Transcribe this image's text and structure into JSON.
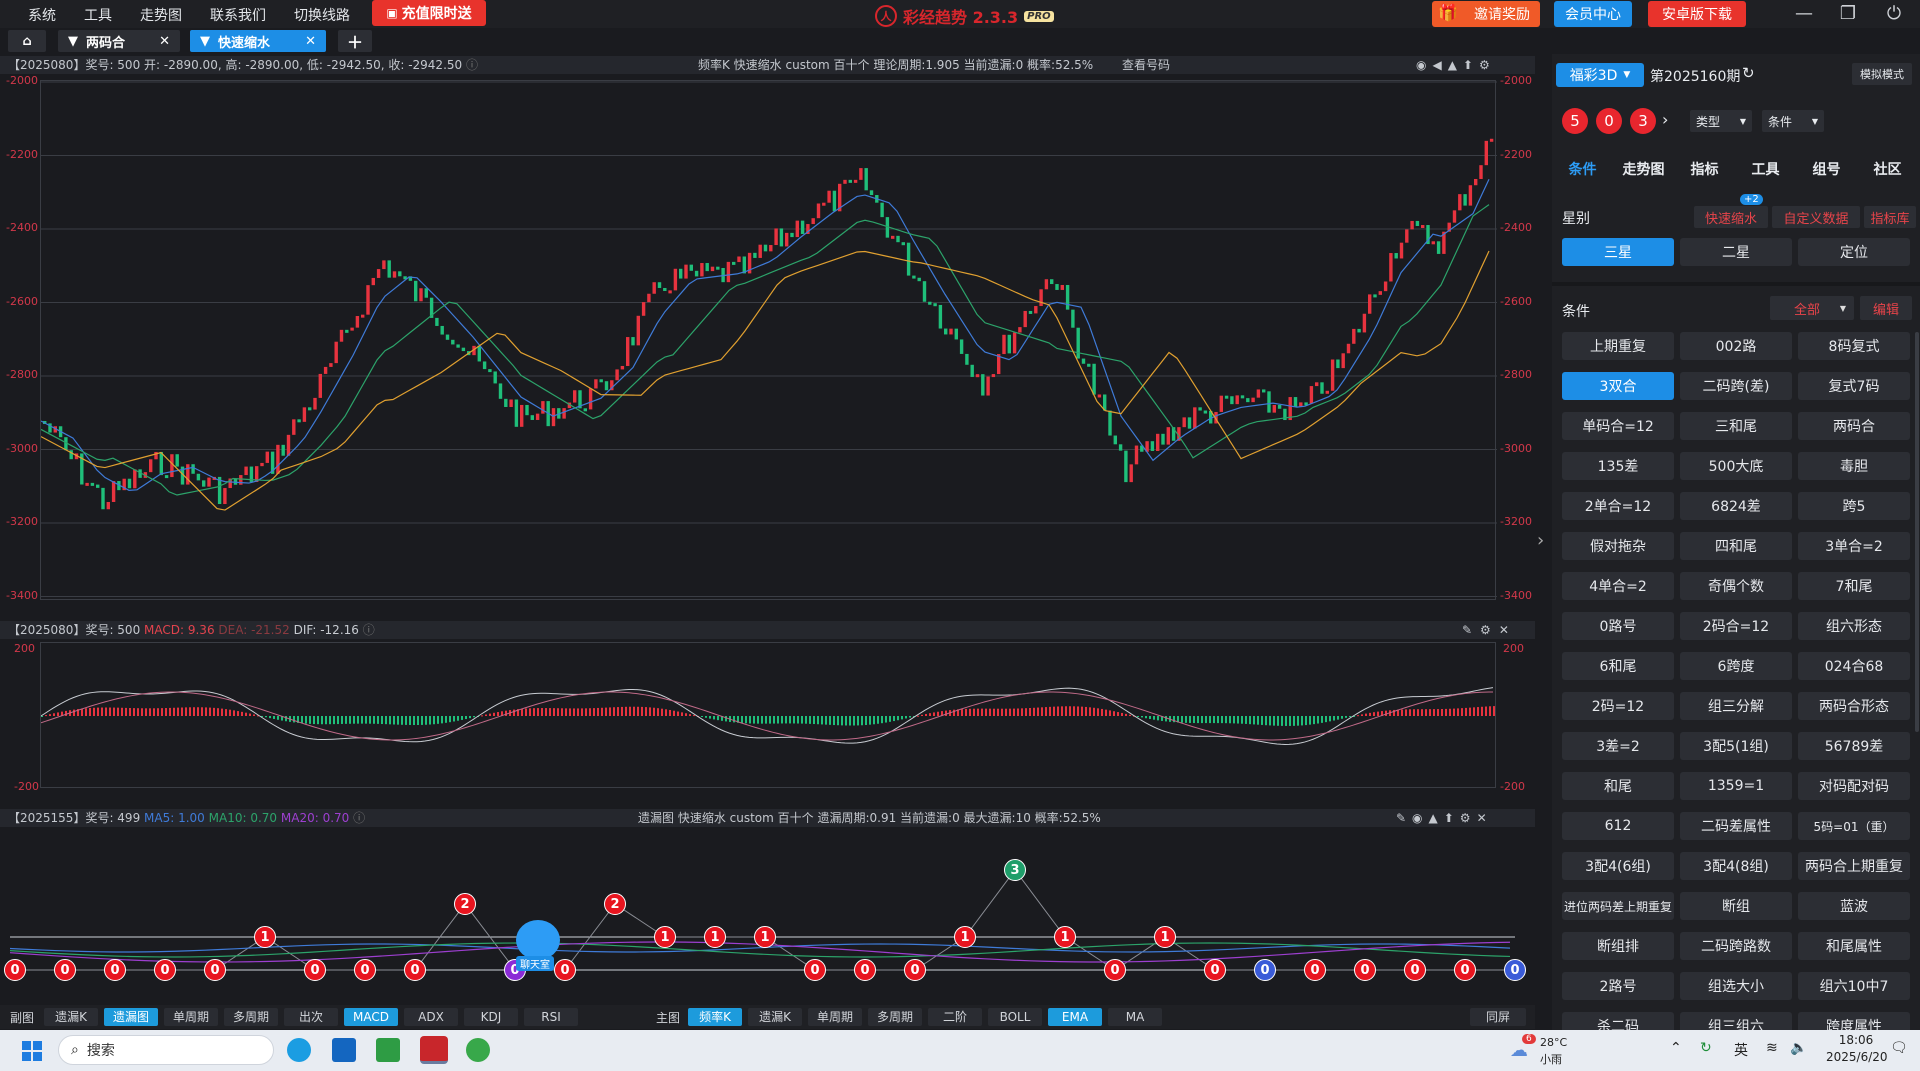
{
  "menu": [
    "系统",
    "工具",
    "走势图",
    "联系我们",
    "切换线路"
  ],
  "promo": "充值限时送",
  "app_title": "彩经趋势 2.3.3",
  "app_badge": "PRO",
  "invite": "邀请奖励",
  "member_center": "会员中心",
  "android_download": "安卓版下载",
  "tabs": [
    {
      "label": "两码合"
    },
    {
      "label": "快速缩水"
    }
  ],
  "chart1": {
    "header_left": "【2025080】奖号: 500  开: -2890.00, 高: -2890.00, 低: -2942.50, 收: -2942.50",
    "header_mid": "频率K  快速缩水  custom  百十个  理论周期:1.905  当前遗漏:0  概率:52.5%",
    "view_number": "查看号码",
    "y_ticks": [
      "-2000",
      "-2200",
      "-2400",
      "-2600",
      "-2800",
      "-3000",
      "-3200",
      "-3400"
    ]
  },
  "chart2": {
    "header_prefix": "【2025080】奖号: 500 ",
    "macd": "MACD: 9.36",
    "dea": "DEA: -21.52",
    "dif": "DIF: -12.16",
    "y_ticks": [
      "200",
      "-200"
    ]
  },
  "chart3": {
    "header_prefix": "【2025155】奖号: 499 ",
    "ma5": "MA5: 1.00",
    "ma10": "MA10: 0.70",
    "ma20": "MA20: 0.70",
    "header_mid": "遗漏图  快速缩水  custom  百十个  遗漏周期:0.91  当前遗漏:0  最大遗漏:10  概率:52.5%",
    "chat_label": "聊天室",
    "balls": [
      {
        "v": "0",
        "c": "#e8151f"
      },
      {
        "v": "0",
        "c": "#e8151f"
      },
      {
        "v": "0",
        "c": "#e8151f"
      },
      {
        "v": "0",
        "c": "#e8151f"
      },
      {
        "v": "0",
        "c": "#e8151f"
      },
      {
        "v": "1",
        "c": "#e8151f"
      },
      {
        "v": "0",
        "c": "#e8151f"
      },
      {
        "v": "0",
        "c": "#e8151f"
      },
      {
        "v": "0",
        "c": "#e8151f"
      },
      {
        "v": "2",
        "c": "#e8151f"
      },
      {
        "v": "0",
        "c": "#8b2bd6"
      },
      {
        "v": "0",
        "c": "#e8151f"
      },
      {
        "v": "2",
        "c": "#e8151f"
      },
      {
        "v": "1",
        "c": "#e8151f"
      },
      {
        "v": "1",
        "c": "#e8151f"
      },
      {
        "v": "1",
        "c": "#e8151f"
      },
      {
        "v": "0",
        "c": "#e8151f"
      },
      {
        "v": "0",
        "c": "#e8151f"
      },
      {
        "v": "0",
        "c": "#e8151f"
      },
      {
        "v": "1",
        "c": "#e8151f"
      },
      {
        "v": "3",
        "c": "#1f9e6a"
      },
      {
        "v": "1",
        "c": "#e8151f"
      },
      {
        "v": "0",
        "c": "#e8151f"
      },
      {
        "v": "1",
        "c": "#e8151f"
      },
      {
        "v": "0",
        "c": "#e8151f"
      },
      {
        "v": "0",
        "c": "#3a5bd8"
      },
      {
        "v": "0",
        "c": "#e8151f"
      },
      {
        "v": "0",
        "c": "#e8151f"
      },
      {
        "v": "0",
        "c": "#e8151f"
      },
      {
        "v": "0",
        "c": "#e8151f"
      },
      {
        "v": "0",
        "c": "#3a5bd8"
      }
    ]
  },
  "bottom_left": {
    "label": "副图",
    "buttons": [
      "遗漏K",
      "遗漏图",
      "单周期",
      "多周期",
      "出次",
      "MACD",
      "ADX",
      "KDJ",
      "RSI"
    ],
    "active": [
      "遗漏图",
      "MACD"
    ]
  },
  "bottom_mid": {
    "label": "主图",
    "buttons": [
      "频率K",
      "遗漏K",
      "单周期",
      "多周期",
      "二阶",
      "BOLL",
      "EMA",
      "MA"
    ],
    "active": [
      "频率K",
      "EMA"
    ]
  },
  "bottom_right": "同屏",
  "right": {
    "lottery": "福彩3D",
    "period": "第2025160期",
    "sim_mode": "模拟模式",
    "balls": [
      "5",
      "0",
      "3"
    ],
    "type_label": "类型",
    "cond_label": "条件",
    "nav": [
      "条件",
      "走势图",
      "指标",
      "工具",
      "组号",
      "社区"
    ],
    "star_label": "星别",
    "quick_links": [
      "快速缩水",
      "自定义数据",
      "指标库"
    ],
    "quick_badge": "+2",
    "star_buttons": [
      "三星",
      "二星",
      "定位"
    ],
    "cond_section": "条件",
    "all_label": "全部",
    "edit_label": "编辑",
    "conditions": [
      "上期重复",
      "002路",
      "8码复式",
      "3双合",
      "二码跨(差)",
      "复式7码",
      "单码合=12",
      "三和尾",
      "两码合",
      "135差",
      "500大底",
      "毒胆",
      "2单合=12",
      "6824差",
      "跨5",
      "假对拖杂",
      "四和尾",
      "3单合=2",
      "4单合=2",
      "奇偶个数",
      "7和尾",
      "0路号",
      "2码合=12",
      "组六形态",
      "6和尾",
      "6跨度",
      "024合68",
      "2码=12",
      "组三分解",
      "两码合形态",
      "3差=2",
      "3配5(1组)",
      "56789差",
      "和尾",
      "1359=1",
      "对码配对码",
      "612",
      "二码差属性",
      "5码=01（重）",
      "3配4(6组)",
      "3配4(8组)",
      "两码合上期重复",
      "进位两码差上期重复",
      "断组",
      "蓝波",
      "断组排",
      "二码跨路数",
      "和尾属性",
      "2路号",
      "组选大小",
      "组六10中7",
      "杀二码",
      "组三组六",
      "跨度属性"
    ],
    "active_condition": "3双合"
  },
  "taskbar": {
    "search": "搜索",
    "weather_temp": "28°C",
    "weather_desc": "小雨",
    "weather_badge": "6",
    "lang": "英",
    "time": "18:06",
    "date": "2025/6/20"
  }
}
